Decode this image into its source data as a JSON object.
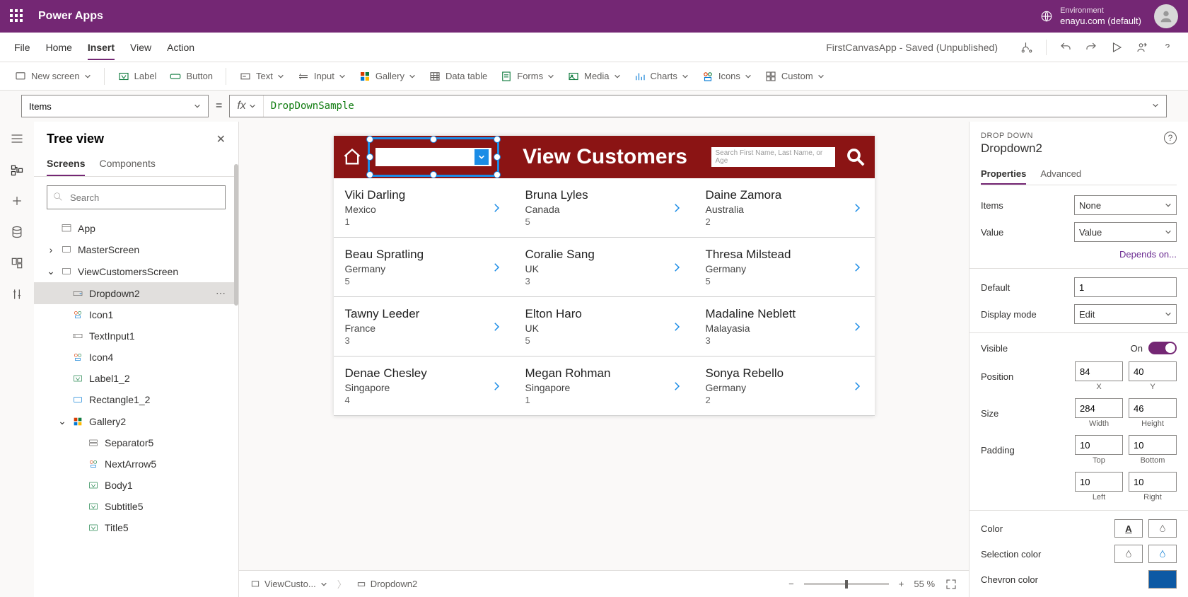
{
  "top": {
    "app": "Power Apps",
    "envLabel": "Environment",
    "envName": "enayu.com (default)"
  },
  "menu": {
    "items": [
      "File",
      "Home",
      "Insert",
      "View",
      "Action"
    ],
    "active": "Insert",
    "status": "FirstCanvasApp - Saved (Unpublished)"
  },
  "ribbon": {
    "newScreen": "New screen",
    "label": "Label",
    "button": "Button",
    "text": "Text",
    "input": "Input",
    "gallery": "Gallery",
    "dataTable": "Data table",
    "forms": "Forms",
    "media": "Media",
    "charts": "Charts",
    "icons": "Icons",
    "custom": "Custom"
  },
  "formula": {
    "prop": "Items",
    "value": "DropDownSample"
  },
  "tree": {
    "title": "Tree view",
    "tabs": [
      "Screens",
      "Components"
    ],
    "activeTab": "Screens",
    "search": "Search",
    "items": [
      {
        "label": "App",
        "depth": 0,
        "icon": "app"
      },
      {
        "label": "MasterScreen",
        "depth": 0,
        "icon": "screen",
        "toggle": ">"
      },
      {
        "label": "ViewCustomersScreen",
        "depth": 0,
        "icon": "screen",
        "toggle": "v"
      },
      {
        "label": "Dropdown2",
        "depth": 1,
        "icon": "dd",
        "selected": true,
        "dots": true
      },
      {
        "label": "Icon1",
        "depth": 1,
        "icon": "iconctrl"
      },
      {
        "label": "TextInput1",
        "depth": 1,
        "icon": "textinput"
      },
      {
        "label": "Icon4",
        "depth": 1,
        "icon": "iconctrl"
      },
      {
        "label": "Label1_2",
        "depth": 1,
        "icon": "label"
      },
      {
        "label": "Rectangle1_2",
        "depth": 1,
        "icon": "rect"
      },
      {
        "label": "Gallery2",
        "depth": 1,
        "icon": "gallery",
        "toggle": "v"
      },
      {
        "label": "Separator5",
        "depth": 2,
        "icon": "sep"
      },
      {
        "label": "NextArrow5",
        "depth": 2,
        "icon": "iconctrl"
      },
      {
        "label": "Body1",
        "depth": 2,
        "icon": "label"
      },
      {
        "label": "Subtitle5",
        "depth": 2,
        "icon": "label"
      },
      {
        "label": "Title5",
        "depth": 2,
        "icon": "label"
      }
    ]
  },
  "breadcrumb": {
    "screen": "ViewCusto...",
    "control": "Dropdown2"
  },
  "zoom": {
    "pct": "55",
    "unit": "%"
  },
  "appPreview": {
    "title": "View Customers",
    "searchPlaceholder": "Search First Name, Last Name, or Age",
    "rows": [
      [
        {
          "name": "Viki  Darling",
          "country": "Mexico",
          "num": "1"
        },
        {
          "name": "Bruna  Lyles",
          "country": "Canada",
          "num": "5"
        },
        {
          "name": "Daine  Zamora",
          "country": "Australia",
          "num": "2"
        }
      ],
      [
        {
          "name": "Beau  Spratling",
          "country": "Germany",
          "num": "5"
        },
        {
          "name": "Coralie  Sang",
          "country": "UK",
          "num": "3"
        },
        {
          "name": "Thresa  Milstead",
          "country": "Germany",
          "num": "5"
        }
      ],
      [
        {
          "name": "Tawny  Leeder",
          "country": "France",
          "num": "3"
        },
        {
          "name": "Elton  Haro",
          "country": "UK",
          "num": "5"
        },
        {
          "name": "Madaline  Neblett",
          "country": "Malayasia",
          "num": "3"
        }
      ],
      [
        {
          "name": "Denae  Chesley",
          "country": "Singapore",
          "num": "4"
        },
        {
          "name": "Megan  Rohman",
          "country": "Singapore",
          "num": "1"
        },
        {
          "name": "Sonya  Rebello",
          "country": "Germany",
          "num": "2"
        }
      ]
    ]
  },
  "props": {
    "type": "DROP DOWN",
    "name": "Dropdown2",
    "tabs": [
      "Properties",
      "Advanced"
    ],
    "activeTab": "Properties",
    "items": "None",
    "value": "Value",
    "depends": "Depends on...",
    "default": "1",
    "displayMode": "Edit",
    "visible": "On",
    "posX": "84",
    "posY": "40",
    "xLbl": "X",
    "yLbl": "Y",
    "width": "284",
    "height": "46",
    "wLbl": "Width",
    "hLbl": "Height",
    "padT": "10",
    "padB": "10",
    "padL": "10",
    "padR": "10",
    "tLbl": "Top",
    "bLbl": "Bottom",
    "lLbl": "Left",
    "rLbl": "Right",
    "labels": {
      "items": "Items",
      "value": "Value",
      "default": "Default",
      "displayMode": "Display mode",
      "visible": "Visible",
      "position": "Position",
      "size": "Size",
      "padding": "Padding",
      "color": "Color",
      "selColor": "Selection color",
      "chevColor": "Chevron color"
    }
  }
}
